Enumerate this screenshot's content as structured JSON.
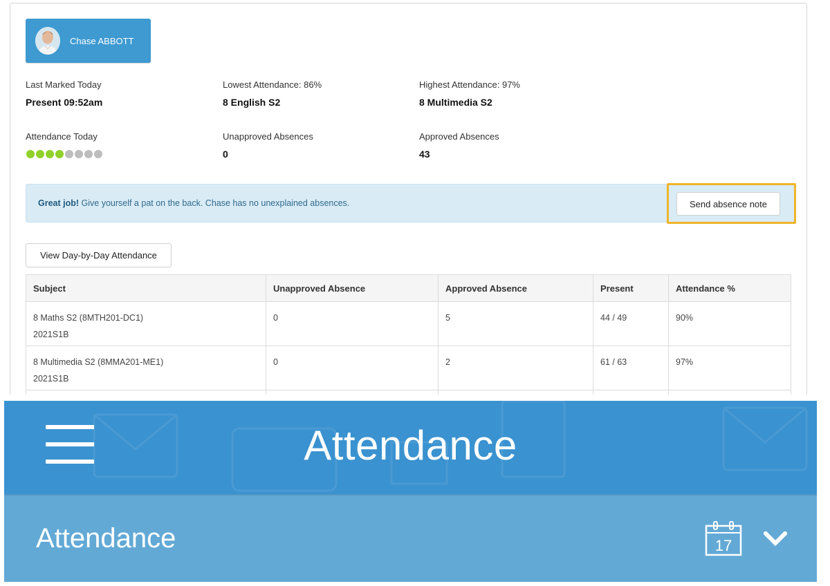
{
  "student": {
    "name": "Chase ABBOTT"
  },
  "stats": {
    "last_marked_label": "Last Marked Today",
    "last_marked_value": "Present 09:52am",
    "lowest_label": "Lowest Attendance: 86%",
    "lowest_value": "8 English S2",
    "highest_label": "Highest Attendance: 97%",
    "highest_value": "8 Multimedia S2",
    "today_label": "Attendance Today",
    "today_dots": {
      "marked": 4,
      "total": 8,
      "marked_color": "#8fd12a",
      "unmarked_color": "#bdbdbd"
    },
    "unapproved_label": "Unapproved Absences",
    "unapproved_value": "0",
    "approved_label": "Approved Absences",
    "approved_value": "43"
  },
  "alert": {
    "strong": "Great job!",
    "message": " Give yourself a pat on the back. Chase has no unexplained absences.",
    "button_label": "Send absence note",
    "highlight_color": "#f0b429"
  },
  "day_by_day_label": "View Day-by-Day Attendance",
  "table": {
    "headers": [
      "Subject",
      "Unapproved Absence",
      "Approved Absence",
      "Present",
      "Attendance %"
    ],
    "rows": [
      {
        "subject": "8 Maths S2 (8MTH201-DC1)",
        "term": "2021S1B",
        "unapproved": "0",
        "approved": "5",
        "present": "44 / 49",
        "percent": "90%"
      },
      {
        "subject": "8 Multimedia S2 (8MMA201-ME1)",
        "term": "2021S1B",
        "unapproved": "0",
        "approved": "2",
        "present": "61 / 63",
        "percent": "97%"
      }
    ]
  },
  "app_header": {
    "title": "Attendance",
    "menu_icon": "hamburger-menu-icon"
  },
  "sub_header": {
    "title": "Attendance",
    "calendar_day": "17",
    "calendar_icon": "calendar-icon",
    "expand_icon": "chevron-down-icon"
  },
  "colors": {
    "header_blue": "#3a92d0",
    "subheader_blue": "#62a9d6",
    "chip_blue": "#3e9ad1",
    "alert_bg": "#d9ebf5"
  }
}
